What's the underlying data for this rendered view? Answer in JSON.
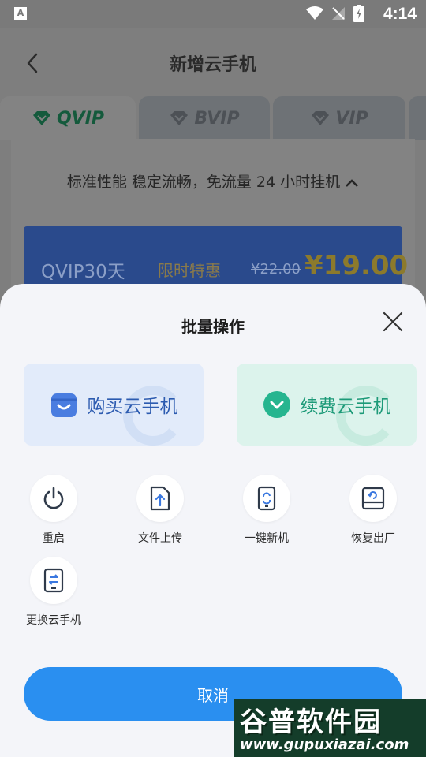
{
  "status_bar": {
    "time": "4:14",
    "app_icon_letter": "A"
  },
  "nav": {
    "title": "新增云手机"
  },
  "tabs": [
    {
      "label": "QVIP"
    },
    {
      "label": "BVIP"
    },
    {
      "label": "VIP"
    }
  ],
  "description": "标准性能 稳定流畅，免流量 24 小时挂机",
  "plan": {
    "name": "QVIP30天",
    "promo": "限时特惠",
    "old_price": "¥22.00",
    "price": "¥19.00"
  },
  "sheet": {
    "title": "批量操作",
    "cards": [
      {
        "label": "购买云手机"
      },
      {
        "label": "续费云手机"
      }
    ],
    "operations": [
      {
        "label": "重启"
      },
      {
        "label": "文件上传"
      },
      {
        "label": "一键新机"
      },
      {
        "label": "恢复出厂"
      },
      {
        "label": "更换云手机"
      }
    ],
    "cancel_label": "取消"
  },
  "watermark": {
    "title": "谷普软件园",
    "url": "www.gupuxiazai.com"
  },
  "colors": {
    "primary": "#2a8ff0",
    "buy_card": "#e2ebfa",
    "renew_card": "#dcf3ec",
    "renew_accent": "#1d9a78",
    "buy_accent": "#4a7de0"
  }
}
